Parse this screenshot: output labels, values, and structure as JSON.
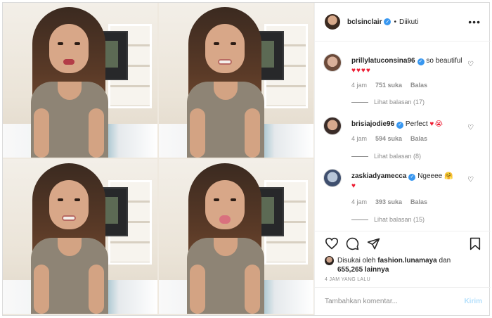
{
  "post": {
    "author": "bclsinclair",
    "separator": "•",
    "follow_status": "Diikuti",
    "more_icon": "more-horizontal-icon"
  },
  "comments": [
    {
      "username": "prillylatuconsina96",
      "text": "so beautiful",
      "emoji": "♥♥♥♥",
      "time": "4 jam",
      "likes": "751 suka",
      "reply_label": "Balas",
      "view_replies": "Lihat balasan (17)"
    },
    {
      "username": "brisiajodie96",
      "text": "Perfect",
      "emoji": "♥😭",
      "time": "4 jam",
      "likes": "594 suka",
      "reply_label": "Balas",
      "view_replies": "Lihat balasan (8)"
    },
    {
      "username": "zaskiadyamecca",
      "text": "Ngeeee",
      "emoji": "🤗",
      "emoji2": "♥",
      "time": "4 jam",
      "likes": "393 suka",
      "reply_label": "Balas",
      "view_replies": "Lihat balasan (15)"
    }
  ],
  "actions": {
    "like_icon": "heart-icon",
    "comment_icon": "comment-icon",
    "share_icon": "share-icon",
    "save_icon": "bookmark-icon"
  },
  "likes": {
    "prefix": "Disukai oleh",
    "user": "fashion.lunamaya",
    "conjunction": "dan",
    "others": "655,265 lainnya"
  },
  "timestamp": "4 JAM YANG LALU",
  "add_comment": {
    "placeholder": "Tambahkan komentar...",
    "submit_label": "Kirim"
  },
  "colors": {
    "verified": "#3897f0",
    "heart_red": "#ed1c32",
    "muted_text": "#8e8e8e",
    "submit_disabled": "#b2dffc"
  }
}
